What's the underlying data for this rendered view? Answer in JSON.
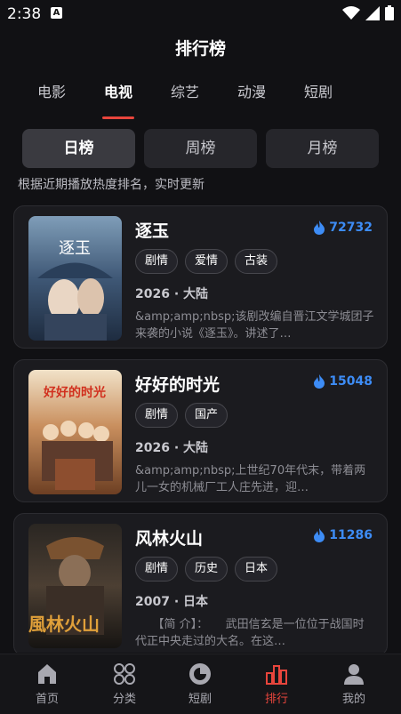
{
  "status": {
    "time": "2:38",
    "notif_icon": "a-icon"
  },
  "header": {
    "title": "排行榜"
  },
  "tabs": [
    {
      "label": "电影"
    },
    {
      "label": "电视"
    },
    {
      "label": "综艺"
    },
    {
      "label": "动漫"
    },
    {
      "label": "短剧"
    }
  ],
  "active_tab": "电视",
  "rank": {
    "day": "日榜",
    "week": "周榜",
    "month": "月榜",
    "active": "日榜"
  },
  "subtitle": "根据近期播放热度排名，实时更新",
  "items": [
    {
      "title": "逐玉",
      "heat": "72732",
      "tags": [
        "剧情",
        "爱情",
        "古装"
      ],
      "meta": "2026 · 大陆",
      "desc": "&amp;amp;nbsp;该剧改编自晋江文学城团子来袭的小说《逐玉》。讲述了…",
      "poster_text": "逐玉"
    },
    {
      "title": "好好的时光",
      "heat": "15048",
      "tags": [
        "剧情",
        "国产"
      ],
      "meta": "2026 · 大陆",
      "desc": "&amp;amp;nbsp;上世纪70年代末，带着两儿一女的机械厂工人庄先进，迎…",
      "poster_text": "好好的时光"
    },
    {
      "title": "风林火山",
      "heat": "11286",
      "tags": [
        "剧情",
        "历史",
        "日本"
      ],
      "meta": "2007 · 日本",
      "desc": "　　【简 介】：　　武田信玄是一位位于战国时代正中央走过的大名。在这…",
      "poster_text": "風林火山"
    }
  ],
  "bottom_nav": [
    {
      "label": "首页",
      "icon": "home-icon"
    },
    {
      "label": "分类",
      "icon": "category-icon"
    },
    {
      "label": "短剧",
      "icon": "shorts-icon"
    },
    {
      "label": "排行",
      "icon": "ranking-icon"
    },
    {
      "label": "我的",
      "icon": "profile-icon"
    }
  ],
  "colors": {
    "accent": "#e8453c",
    "heat": "#3d8cf5",
    "background": "#111114",
    "card": "#1b1b1f"
  }
}
